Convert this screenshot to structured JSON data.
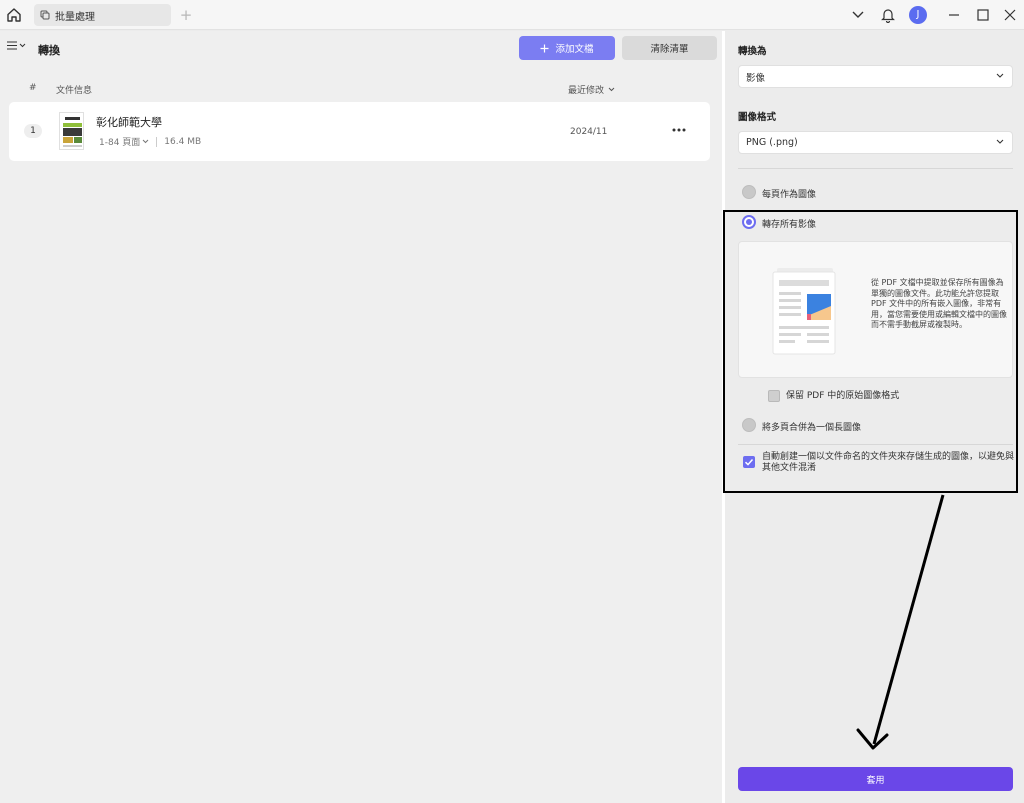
{
  "topbar": {
    "tab_label": "批量處理",
    "avatar_letter": "J"
  },
  "main": {
    "title": "轉換",
    "add_button": "添加文檔",
    "clear_button": "清除清單",
    "columns": {
      "index": "#",
      "file_info": "文件信息",
      "last_modified": "最近修改"
    },
    "files": [
      {
        "index": "1",
        "name": "彰化師範大學",
        "pages": "1-84 頁面",
        "size": "16.4 MB",
        "date": "2024/11"
      }
    ]
  },
  "panel": {
    "convert_to_label": "轉換為",
    "convert_to_value": "影像",
    "image_format_label": "圖像格式",
    "image_format_value": "PNG (.png)",
    "options": {
      "each_page": "每頁作為圖像",
      "extract_all": "轉存所有影像",
      "merge_pages": "將多頁合併為一個長圖像"
    },
    "selected_option": "extract_all",
    "extract_description": "從 PDF 文檔中提取並保存所有圖像為單獨的圖像文件。此功能允許您提取 PDF 文件中的所有嵌入圖像，非常有用，當您需要使用或編輯文檔中的圖像而不需手動截屏或複製時。",
    "keep_original_format": "保留 PDF 中的原始圖像格式",
    "keep_original_format_checked": false,
    "auto_folder": "自動創建一個以文件命名的文件夾來存儲生成的圖像，以避免與其他文件混淆",
    "auto_folder_checked": true,
    "apply_button": "套用"
  },
  "colors": {
    "accent": "#7b7df2",
    "apply": "#6a47e8",
    "radio_selected": "#6d6df0"
  }
}
